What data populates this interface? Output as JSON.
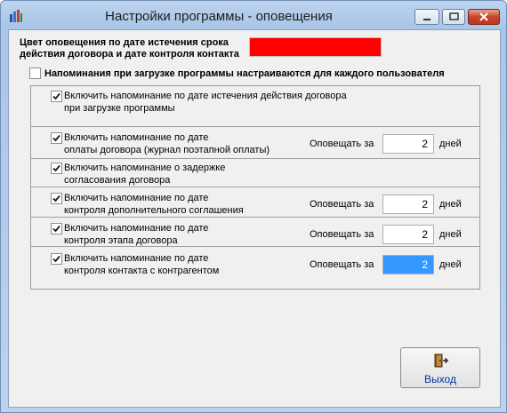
{
  "window": {
    "title": "Настройки программы - оповещения"
  },
  "color_setting": {
    "label_line1": "Цвет оповещения по дате истечения срока",
    "label_line2": "действия договора и датe контроля контакта",
    "color": "#ff0000"
  },
  "per_user": {
    "label": "Напоминания при загрузке программы настраиваются для каждого пользователя",
    "checked": false
  },
  "items": [
    {
      "line1": "Включить напоминание по дате истечения действия договора",
      "line2": "при загрузке программы",
      "checked": true
    },
    {
      "line1": "Включить напоминание по дате",
      "line2": "оплаты договора (журнал поэтапной оплаты)",
      "checked": true,
      "notify_label": "Оповещать за",
      "value": "2",
      "unit": "дней"
    },
    {
      "line1": "Включить напоминание о задержке",
      "line2": "согласования договора",
      "checked": true
    },
    {
      "line1": "Включить напоминание по дате",
      "line2": "контроля дополнительного соглашения",
      "checked": true,
      "notify_label": "Оповещать за",
      "value": "2",
      "unit": "дней"
    },
    {
      "line1": "Включить напоминание по дате",
      "line2": "контроля этапа договора",
      "checked": true,
      "notify_label": "Оповещать за",
      "value": "2",
      "unit": "дней"
    },
    {
      "line1": "Включить напоминание по дате",
      "line2": "контроля контакта с контрагентом",
      "checked": true,
      "notify_label": "Оповещать за",
      "value": "2",
      "unit": "дней"
    }
  ],
  "exit_button": {
    "label": "Выход"
  }
}
